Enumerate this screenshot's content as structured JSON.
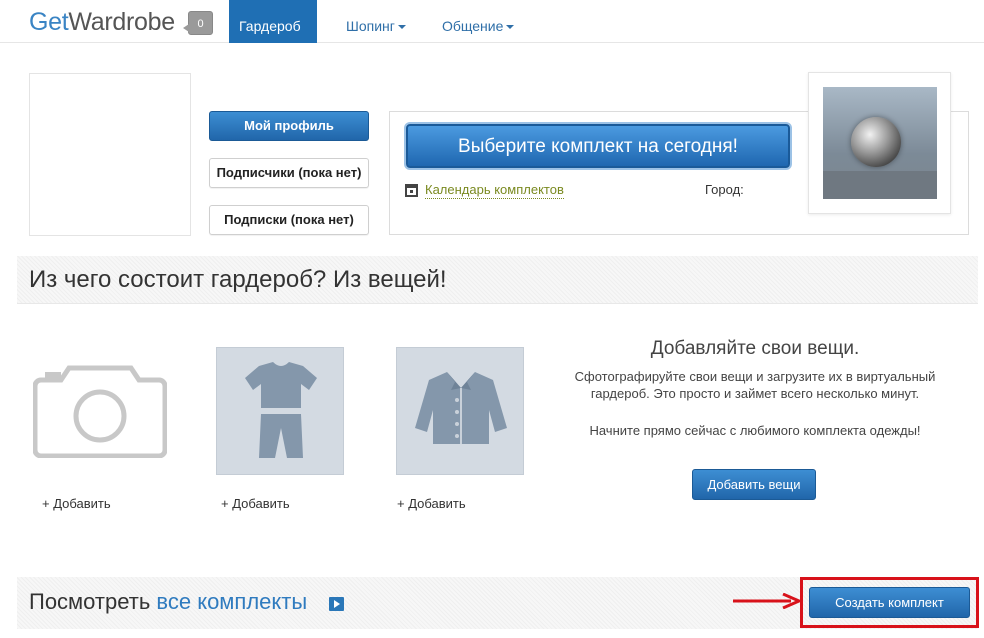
{
  "header": {
    "logo_get": "Get",
    "logo_wardrobe": "Wardrobe",
    "notification_count": "0",
    "nav": [
      {
        "label": "Гардероб",
        "active": true
      },
      {
        "label": "Шопинг",
        "active": false
      },
      {
        "label": "Общение",
        "active": false
      }
    ]
  },
  "profile": {
    "my_profile_label": "Мой профиль",
    "followers_label": "Подписчики (пока нет)",
    "following_label": "Подписки (пока нет)"
  },
  "outfit": {
    "choose_label": "Выберите комплект на сегодня!",
    "calendar_label": "Календарь комплектов",
    "city_label": "Город:"
  },
  "wardrobe_section": {
    "title": "Из чего состоит гардероб? Из вещей!",
    "add_labels": [
      "+ Добавить",
      "+ Добавить",
      "+ Добавить"
    ],
    "promo_title": "Добавляйте свои вещи.",
    "promo_description": "Сфотографируйте свои вещи и загрузите их в виртуальный гардероб. Это просто и займет всего несколько минут.",
    "promo_cta": "Начните прямо сейчас с любимого комплекта одежды!",
    "add_items_button": "Добавить вещи"
  },
  "outfits_section": {
    "view_prefix": "Посмотреть ",
    "view_link": "все комплекты",
    "create_button": "Создать комплект"
  },
  "colors": {
    "accent": "#1f6fb4",
    "link": "#2f7bbf",
    "highlight": "#d8121a"
  }
}
